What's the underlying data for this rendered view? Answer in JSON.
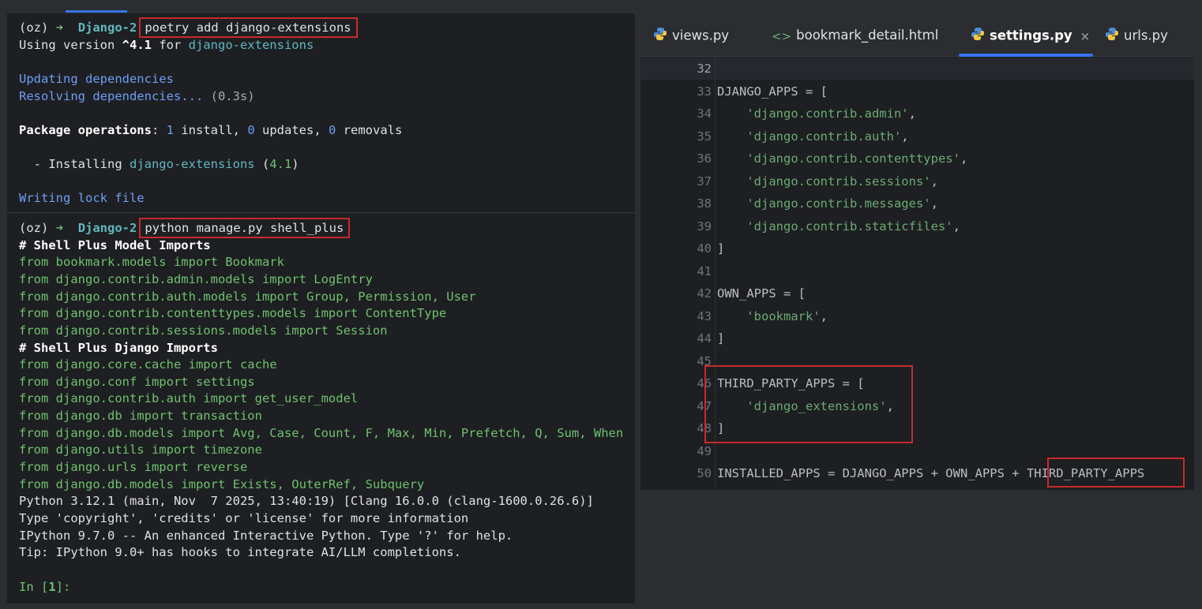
{
  "terminal": {
    "top": {
      "prompt_env": "(oz)",
      "prompt_arrow": "➜",
      "prompt_dir": "Django-2",
      "command": "poetry add django-extensions",
      "using_prefix": "Using version ",
      "using_version": "^4.1",
      "using_for": " for ",
      "using_pkg": "django-extensions",
      "updating": "Updating dependencies",
      "resolving": "Resolving dependencies...",
      "resolving_time": " (0.3s)",
      "pkg_ops_label": "Package operations",
      "pkg_ops_sep": ": ",
      "pkg_install_n": "1",
      "pkg_install": " install, ",
      "pkg_updates_n": "0",
      "pkg_updates": " updates, ",
      "pkg_removals_n": "0",
      "pkg_removals": " removals",
      "installing_prefix": "  - Installing ",
      "installing_pkg": "django-extensions",
      "installing_open": " (",
      "installing_ver": "4.1",
      "installing_close": ")",
      "writing_lock": "Writing lock file"
    },
    "bottom": {
      "prompt_env": "(oz)",
      "prompt_arrow": "➜",
      "prompt_dir": "Django-2",
      "command": "python manage.py shell_plus",
      "model_imports_header": "# Shell Plus Model Imports",
      "model_imports": [
        "from bookmark.models import Bookmark",
        "from django.contrib.admin.models import LogEntry",
        "from django.contrib.auth.models import Group, Permission, User",
        "from django.contrib.contenttypes.models import ContentType",
        "from django.contrib.sessions.models import Session"
      ],
      "django_imports_header": "# Shell Plus Django Imports",
      "django_imports": [
        "from django.core.cache import cache",
        "from django.conf import settings",
        "from django.contrib.auth import get_user_model",
        "from django.db import transaction",
        "from django.db.models import Avg, Case, Count, F, Max, Min, Prefetch, Q, Sum, When",
        "from django.utils import timezone",
        "from django.urls import reverse",
        "from django.db.models import Exists, OuterRef, Subquery"
      ],
      "python_info": "Python 3.12.1 (main, Nov  7 2025, 13:40:19) [Clang 16.0.0 (clang-1600.0.26.6)]",
      "type_info": "Type 'copyright', 'credits' or 'license' for more information",
      "ipython_info": "IPython 9.7.0 -- An enhanced Interactive Python. Type '?' for help.",
      "tip": "Tip: IPython 9.0+ has hooks to integrate AI/LLM completions.",
      "in_prefix": "In [",
      "in_num": "1",
      "in_suffix": "]:"
    }
  },
  "editor": {
    "tabs": [
      {
        "label": "views.py",
        "icon": "python-file-icon"
      },
      {
        "label": "bookmark_detail.html",
        "icon": "html-file-icon"
      },
      {
        "label": "settings.py",
        "icon": "python-file-icon",
        "active": true,
        "close": "×"
      },
      {
        "label": "urls.py",
        "icon": "python-file-icon"
      }
    ],
    "lines": [
      {
        "n": "32",
        "t": ""
      },
      {
        "n": "33",
        "t": "DJANGO_APPS = ["
      },
      {
        "n": "34",
        "s": "'django.contrib.admin'",
        "e": ","
      },
      {
        "n": "35",
        "s": "'django.contrib.auth'",
        "e": ","
      },
      {
        "n": "36",
        "s": "'django.contrib.contenttypes'",
        "e": ","
      },
      {
        "n": "37",
        "s": "'django.contrib.sessions'",
        "e": ","
      },
      {
        "n": "38",
        "s": "'django.contrib.messages'",
        "e": ","
      },
      {
        "n": "39",
        "s": "'django.contrib.staticfiles'",
        "e": ","
      },
      {
        "n": "40",
        "t": "]"
      },
      {
        "n": "41",
        "t": ""
      },
      {
        "n": "42",
        "t": "OWN_APPS = ["
      },
      {
        "n": "43",
        "s": "'bookmark'",
        "e": ","
      },
      {
        "n": "44",
        "t": "]"
      },
      {
        "n": "45",
        "t": ""
      },
      {
        "n": "46",
        "t": "THIRD_PARTY_APPS = ["
      },
      {
        "n": "47",
        "s": "'django_extensions'",
        "e": ","
      },
      {
        "n": "48",
        "t": "]"
      },
      {
        "n": "49",
        "t": ""
      },
      {
        "n": "50",
        "t": "INSTALLED_APPS = DJANGO_APPS + OWN_APPS + ",
        "box": "THIRD_PARTY_APPS"
      }
    ]
  },
  "colors": {
    "highlight_box": "#c92a2a",
    "accent": "#3574f0",
    "string": "#6aab73",
    "terminal_green": "#6ec26e"
  }
}
